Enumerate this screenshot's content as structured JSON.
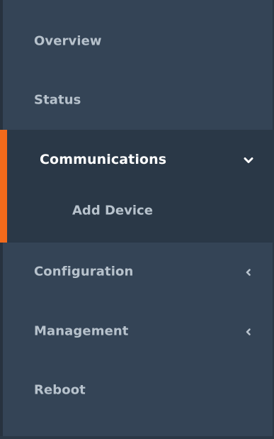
{
  "sidebar": {
    "items": [
      {
        "label": "Overview"
      },
      {
        "label": "Status"
      },
      {
        "label": "Communications",
        "expanded": true,
        "active": true
      },
      {
        "label": "Configuration",
        "expanded": false
      },
      {
        "label": "Management",
        "expanded": false
      },
      {
        "label": "Reboot"
      }
    ],
    "submenu": {
      "communications": [
        {
          "label": "Add Device"
        }
      ]
    },
    "icons": {
      "expanded": "chevron-down-icon",
      "collapsed": "chevron-left-icon"
    },
    "colors": {
      "background": "#344456",
      "active_background": "#2a3847",
      "accent": "#f26a1b",
      "text": "#b7c2cc",
      "active_text": "#ffffff"
    }
  }
}
